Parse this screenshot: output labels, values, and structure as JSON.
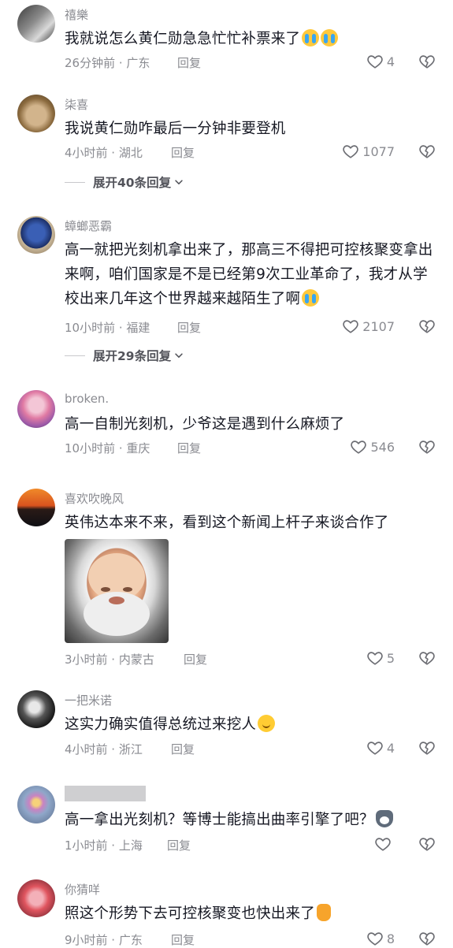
{
  "comments": [
    {
      "username": "禧樂",
      "text": "我就说怎么黄仁勋急急忙忙补票来了",
      "emojis": [
        "cry-emoji",
        "cry-emoji"
      ],
      "time": "26分钟前 · 广东",
      "reply_label": "回复",
      "likes": "4"
    },
    {
      "username": "柒喜",
      "text": "我说黄仁勋咋最后一分钟非要登机",
      "time": "4小时前 · 湖北",
      "reply_label": "回复",
      "likes": "1077",
      "expand": "展开40条回复"
    },
    {
      "username": "蟑螂恶霸",
      "text": "高一就把光刻机拿出来了，那高三不得把可控核聚变拿出来啊，咱们国家是不是已经第9次工业革命了，我才从学校出来几年这个世界越来越陌生了啊",
      "emojis": [
        "cry-emoji"
      ],
      "time": "10小时前 · 福建",
      "reply_label": "回复",
      "likes": "2107",
      "expand": "展开29条回复"
    },
    {
      "username": "broken.",
      "text": "高一自制光刻机，少爷这是遇到什么麻烦了",
      "time": "10小时前 · 重庆",
      "reply_label": "回复",
      "likes": "546"
    },
    {
      "username": "喜欢吹晚风",
      "text": "英伟达本来不来，看到这个新闻上杆子来谈合作了",
      "time": "3小时前 · 内蒙古",
      "reply_label": "回复",
      "likes": "5"
    },
    {
      "username": "一把米诺",
      "text": "这实力确实值得总统过来挖人",
      "emojis": [
        "smile-emoji"
      ],
      "time": "4小时前 · 浙江",
      "reply_label": "回复",
      "likes": "4"
    },
    {
      "username": "",
      "text": "高一拿出光刻机？等博士能搞出曲率引擎了吧？",
      "emojis": [
        "husky-emoji"
      ],
      "time": "1小时前 · 上海",
      "reply_label": "回复",
      "likes": ""
    },
    {
      "username": "你猜咩",
      "text": "照这个形势下去可控核聚变也快出来了",
      "emojis": [
        "thumbs-up-emoji"
      ],
      "time": "9小时前 · 广东",
      "reply_label": "回复",
      "likes": "8"
    }
  ],
  "icons": {
    "like": "heart-outline-icon",
    "dislike": "broken-heart-icon",
    "expand": "chevron-down-icon"
  },
  "colors": {
    "text": "#161823",
    "meta": "#8a8b91",
    "expand": "#52535a"
  }
}
